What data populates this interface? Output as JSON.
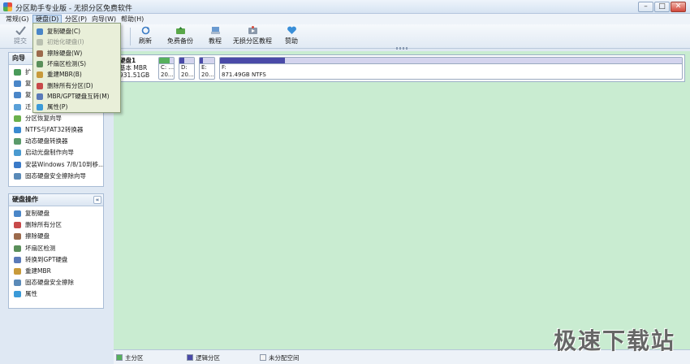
{
  "window": {
    "title": "分区助手专业版 - 无损分区免费软件"
  },
  "menubar": {
    "items": [
      "常规(G)",
      "硬盘(D)",
      "分区(P)",
      "向导(W)",
      "帮助(H)"
    ]
  },
  "toolbar": {
    "items": [
      {
        "label": "提交",
        "icon": "check-icon"
      },
      {
        "label": "刷新",
        "icon": "refresh-icon"
      },
      {
        "label": "免费备份",
        "icon": "backup-icon"
      },
      {
        "label": "教程",
        "icon": "tutorial-icon"
      },
      {
        "label": "无损分区教程",
        "icon": "video-icon"
      },
      {
        "label": "赞助",
        "icon": "heart-icon"
      }
    ]
  },
  "disk_menu": {
    "items": [
      {
        "label": "复制硬盘(C)",
        "disabled": false,
        "color": "#4a86c8"
      },
      {
        "label": "初始化硬盘(I)",
        "disabled": true,
        "color": "#b9c0b0"
      },
      {
        "label": "擦除硬盘(W)",
        "disabled": false,
        "color": "#9c6a4c"
      },
      {
        "label": "坏扇区检测(S)",
        "disabled": false,
        "color": "#5a8f5a"
      },
      {
        "label": "重建MBR(B)",
        "disabled": false,
        "color": "#c89a3a"
      },
      {
        "label": "删除所有分区(D)",
        "disabled": false,
        "color": "#c84a4a"
      },
      {
        "label": "MBR/GPT硬盘互转(M)",
        "disabled": false,
        "color": "#5a7ab8"
      },
      {
        "label": "属性(P)",
        "disabled": false,
        "color": "#3a9ad8"
      }
    ]
  },
  "wizard_panel": {
    "title": "向导",
    "items": [
      {
        "label": "扩",
        "color": "#4a9a5a"
      },
      {
        "label": "复",
        "color": "#4a86c8"
      },
      {
        "label": "复",
        "color": "#4a86c8"
      },
      {
        "label": "迁",
        "color": "#5aa0d8"
      },
      {
        "label": "分区恢复向导",
        "color": "#6ab04c"
      },
      {
        "label": "NTFS与FAT32转换器",
        "color": "#3a8ad0"
      },
      {
        "label": "动态硬盘转换器",
        "color": "#5a9a6a"
      },
      {
        "label": "启动光盘制作向导",
        "color": "#4a9ad0"
      },
      {
        "label": "安装Windows 7/8/10到移...",
        "color": "#3a7ac8"
      },
      {
        "label": "固态硬盘安全擦除向导",
        "color": "#5a8ab8"
      }
    ]
  },
  "disk_ops_panel": {
    "title": "硬盘操作",
    "collapse": "«",
    "items": [
      {
        "label": "复制硬盘",
        "color": "#4a86c8"
      },
      {
        "label": "删除所有分区",
        "color": "#c84a4a"
      },
      {
        "label": "擦除硬盘",
        "color": "#9c6a4c"
      },
      {
        "label": "坏扇区检测",
        "color": "#5a8f5a"
      },
      {
        "label": "转换到GPT硬盘",
        "color": "#5a7ab8"
      },
      {
        "label": "重建MBR",
        "color": "#c89a3a"
      },
      {
        "label": "固态硬盘安全擦除",
        "color": "#5a8ab8"
      },
      {
        "label": "属性",
        "color": "#3a9ad8"
      }
    ]
  },
  "disk": {
    "name": "硬盘1",
    "type": "基本 MBR",
    "size": "931.51GB",
    "partitions": [
      {
        "label": "C: ...",
        "size": "20...",
        "bar_color": "#56b05c",
        "usage": 0.7
      },
      {
        "label": "D:",
        "size": "20...",
        "bar_color": "#4a4aa8",
        "usage": 0.35
      },
      {
        "label": "E:",
        "size": "20...",
        "bar_color": "#4a4aa8",
        "usage": 0.2
      },
      {
        "label": "F:",
        "size": "871.49GB NTFS",
        "bar_color": "#4a4aa8",
        "usage": 0.14
      }
    ]
  },
  "statusbar": {
    "legend": [
      {
        "label": "主分区",
        "color": "#56b05c"
      },
      {
        "label": "逻辑分区",
        "color": "#4a4aa8"
      },
      {
        "label": "未分配空间",
        "color": "#f4f4f4"
      }
    ]
  },
  "watermark": "极速下载站",
  "window_controls": {
    "minimize": "–",
    "maximize": "□",
    "close": "✕"
  }
}
